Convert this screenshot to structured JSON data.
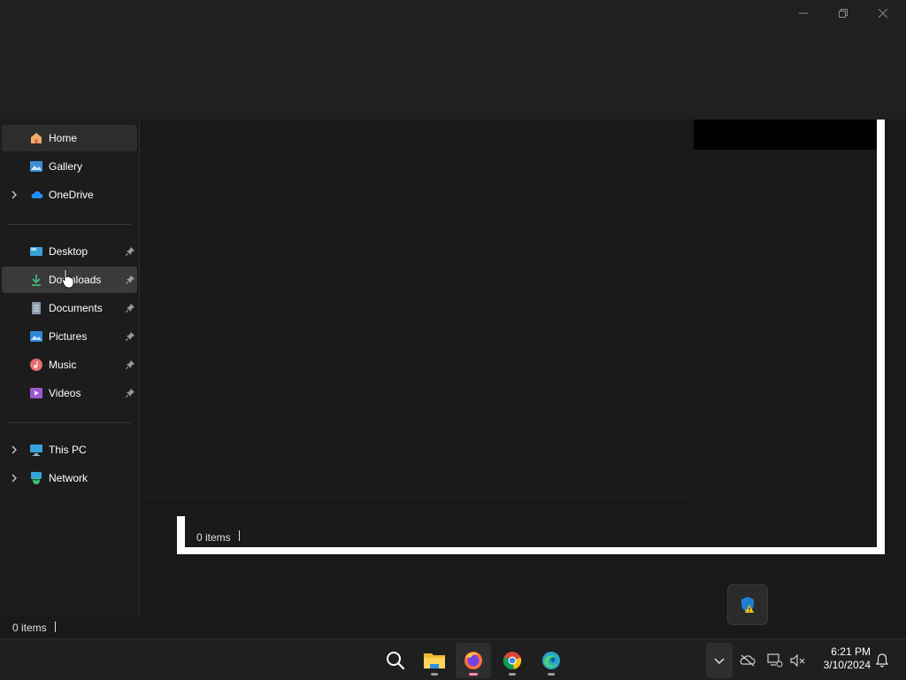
{
  "window": {
    "controls": {
      "minimize_icon": "minimize-icon",
      "maximize_icon": "restore-icon",
      "close_icon": "close-icon"
    }
  },
  "sidebar": {
    "top_items": [
      {
        "label": "Home",
        "icon": "home-icon",
        "selected": true
      },
      {
        "label": "Gallery",
        "icon": "gallery-icon"
      },
      {
        "label": "OneDrive",
        "icon": "onedrive-icon",
        "expandable": true
      }
    ],
    "quick_access": [
      {
        "label": "Desktop",
        "icon": "desktop-icon",
        "pinned": true
      },
      {
        "label": "Downloads",
        "icon": "downloads-icon",
        "pinned": true,
        "hovered": true
      },
      {
        "label": "Documents",
        "icon": "documents-icon",
        "pinned": true
      },
      {
        "label": "Pictures",
        "icon": "pictures-icon",
        "pinned": true
      },
      {
        "label": "Music",
        "icon": "music-icon",
        "pinned": true
      },
      {
        "label": "Videos",
        "icon": "videos-icon",
        "pinned": true
      }
    ],
    "locations": [
      {
        "label": "This PC",
        "icon": "this-pc-icon",
        "expandable": true
      },
      {
        "label": "Network",
        "icon": "network-icon",
        "expandable": true
      }
    ]
  },
  "inner_window": {
    "status": "0 items"
  },
  "statusbar": {
    "status": "0 items"
  },
  "taskbar": {
    "apps": [
      "search-icon",
      "file-explorer-icon",
      "firefox-icon",
      "chrome-icon",
      "edge-icon"
    ],
    "clock": {
      "time": "6:21 PM",
      "date": "3/10/2024"
    }
  },
  "colors": {
    "accent": "#0078d4",
    "background": "#191919",
    "sidebar": "#1c1c1c",
    "taskbar": "#1f1f1f"
  }
}
